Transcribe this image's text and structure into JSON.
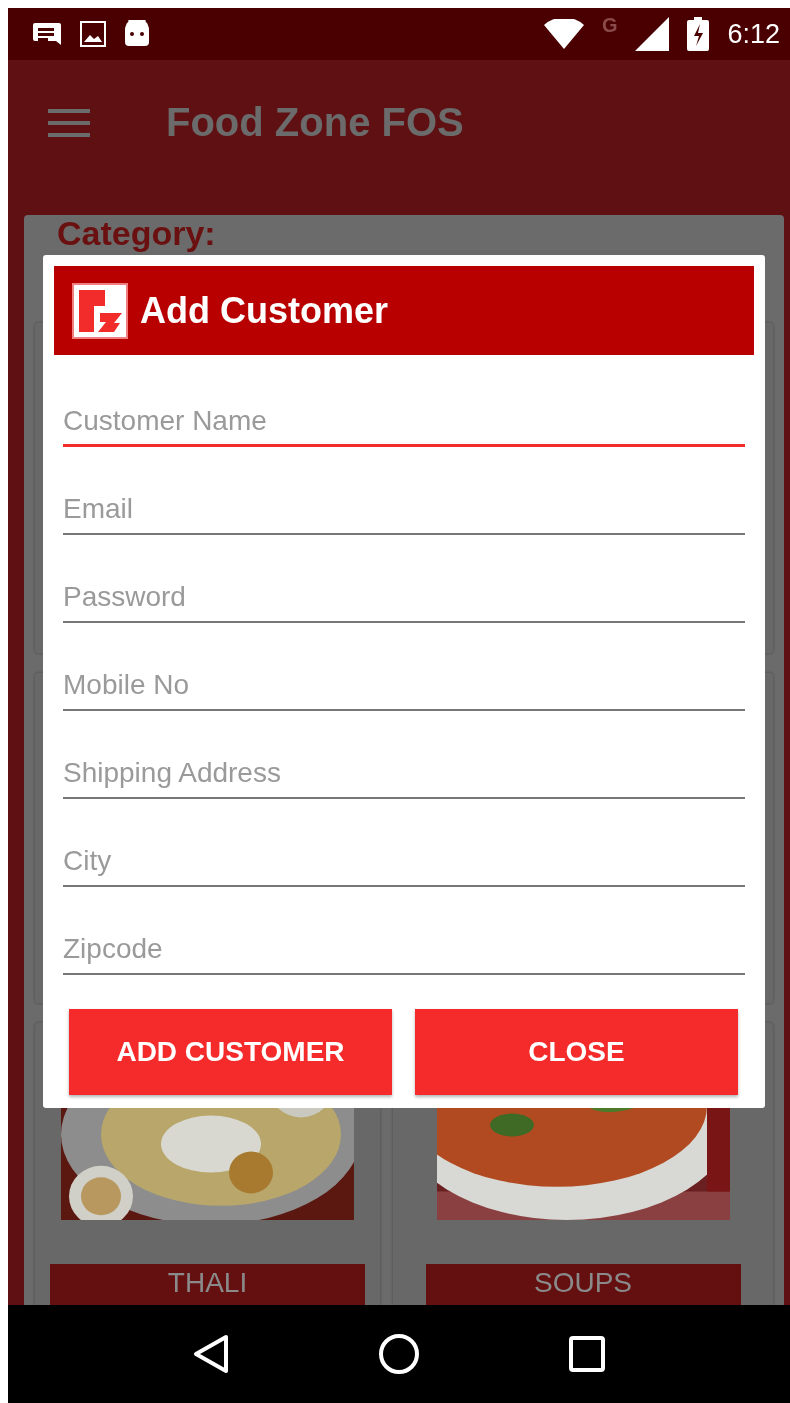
{
  "status_bar": {
    "network": "G",
    "time": "6:12"
  },
  "app_bar": {
    "title": "Food Zone FOS"
  },
  "category_heading": "Category:",
  "categories": [
    {
      "label": "THALI",
      "kind": "thali"
    },
    {
      "label": "SOUPS",
      "kind": "soup"
    }
  ],
  "dialog": {
    "title": "Add Customer",
    "fields": [
      {
        "placeholder": "Customer Name",
        "focused": true
      },
      {
        "placeholder": "Email",
        "focused": false
      },
      {
        "placeholder": "Password",
        "focused": false
      },
      {
        "placeholder": "Mobile No",
        "focused": false
      },
      {
        "placeholder": "Shipping Address",
        "focused": false
      },
      {
        "placeholder": "City",
        "focused": false
      },
      {
        "placeholder": "Zipcode",
        "focused": false
      }
    ],
    "buttons": [
      "ADD CUSTOMER",
      "CLOSE"
    ]
  }
}
